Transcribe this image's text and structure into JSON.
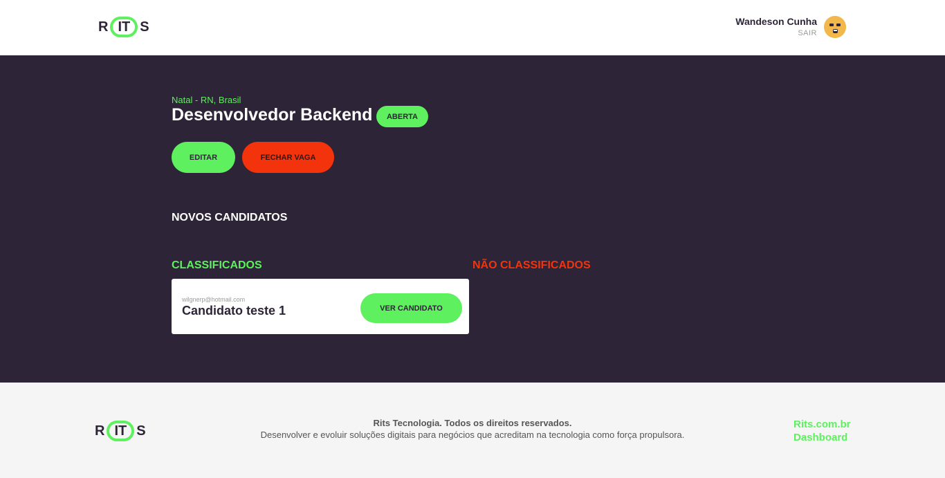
{
  "header": {
    "logo": {
      "left": "R",
      "middle": "IT",
      "right": "S"
    },
    "user": {
      "name": "Wandeson Cunha",
      "logout_label": "SAIR"
    }
  },
  "job": {
    "location": "Natal - RN, Brasil",
    "title": "Desenvolvedor Backend",
    "status": "ABERTA",
    "edit_label": "EDITAR",
    "close_label": "FECHAR VAGA"
  },
  "candidates": {
    "new_heading": "NOVOS CANDIDATOS",
    "classified_heading": "CLASSIFICADOS",
    "unclassified_heading": "NÃO CLASSIFICADOS",
    "classified": [
      {
        "email": "wilgnerp@hotmail.com",
        "name": "Candidato teste 1",
        "action_label": "VER CANDIDATO"
      }
    ]
  },
  "footer": {
    "logo": {
      "left": "R",
      "middle": "IT",
      "right": "S"
    },
    "copyright": "Rits Tecnologia. Todos os direitos reservados.",
    "description": "Desenvolver e evoluir soluções digitais para negócios que acreditam na tecnologia como força propulsora.",
    "links": [
      {
        "label": "Rits.com.br"
      },
      {
        "label": "Dashboard"
      }
    ]
  },
  "colors": {
    "brand_dark": "#2e2438",
    "brand_green": "#5ef05e",
    "alert_red": "#f2330c"
  }
}
